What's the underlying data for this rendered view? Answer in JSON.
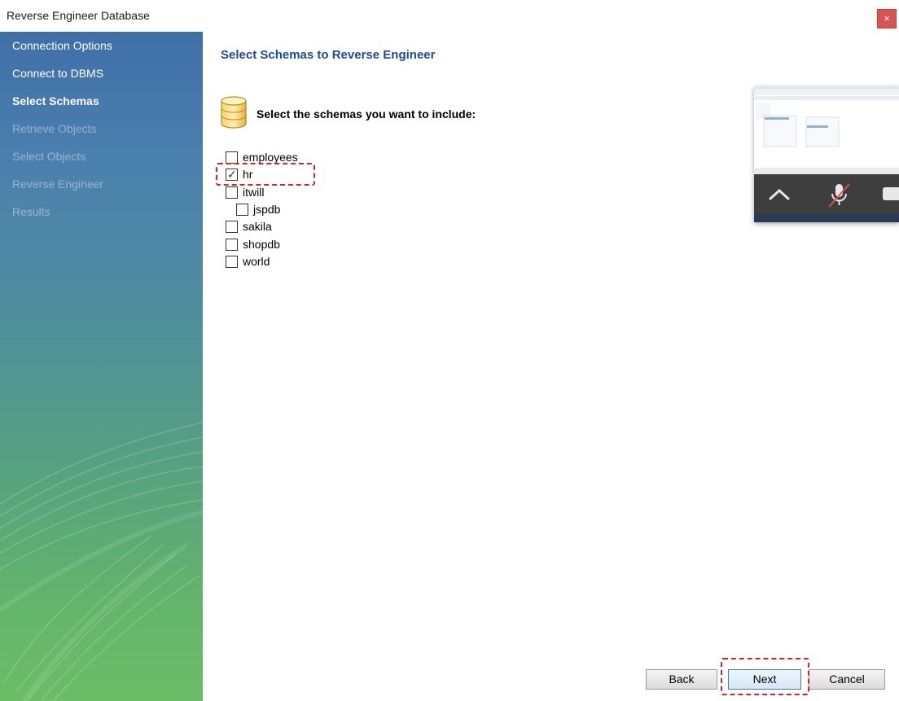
{
  "window": {
    "title": "Reverse Engineer Database",
    "close_glyph": "×"
  },
  "sidebar": {
    "steps": [
      {
        "label": "Connection Options",
        "state": "done"
      },
      {
        "label": "Connect to DBMS",
        "state": "done"
      },
      {
        "label": "Select Schemas",
        "state": "current"
      },
      {
        "label": "Retrieve Objects",
        "state": "pending"
      },
      {
        "label": "Select Objects",
        "state": "pending"
      },
      {
        "label": "Reverse Engineer",
        "state": "pending"
      },
      {
        "label": "Results",
        "state": "pending"
      }
    ]
  },
  "main": {
    "heading": "Select Schemas to Reverse Engineer",
    "instruction": "Select the schemas you want to include:",
    "icon": "database-icon",
    "schemas": [
      {
        "name": "employees",
        "checked": false
      },
      {
        "name": "hr",
        "checked": true
      },
      {
        "name": "itwill",
        "checked": false
      },
      {
        "name": "jspdb",
        "checked": false
      },
      {
        "name": "sakila",
        "checked": false
      },
      {
        "name": "shopdb",
        "checked": false
      },
      {
        "name": "world",
        "checked": false
      }
    ]
  },
  "buttons": {
    "back": "Back",
    "next": "Next",
    "cancel": "Cancel"
  },
  "colors": {
    "heading": "#1d4b93",
    "highlight": "#e02020",
    "close": "#d9534f"
  }
}
